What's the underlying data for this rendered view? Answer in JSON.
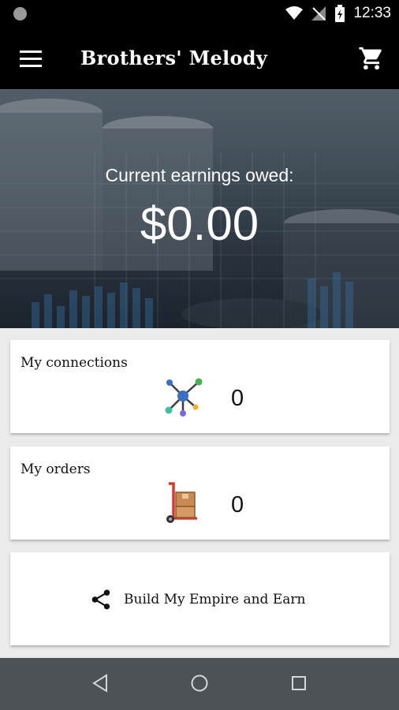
{
  "status_bar": {
    "time": "12:33"
  },
  "app_bar": {
    "title": "Brothers' Melody"
  },
  "hero": {
    "caption": "Current earnings owed:",
    "amount": "$0.00"
  },
  "cards": {
    "connections": {
      "label": "My connections",
      "count": "0"
    },
    "orders": {
      "label": "My orders",
      "count": "0"
    },
    "share": {
      "label": "Build My Empire and Earn"
    }
  },
  "icons": {
    "menu": "menu-icon",
    "cart": "cart-icon",
    "connections": "network-icon",
    "orders": "hand-truck-icon",
    "share": "share-icon"
  },
  "colors": {
    "bar_background": "#000000",
    "nav_bar": "#4d5257",
    "card": "#ffffff"
  }
}
